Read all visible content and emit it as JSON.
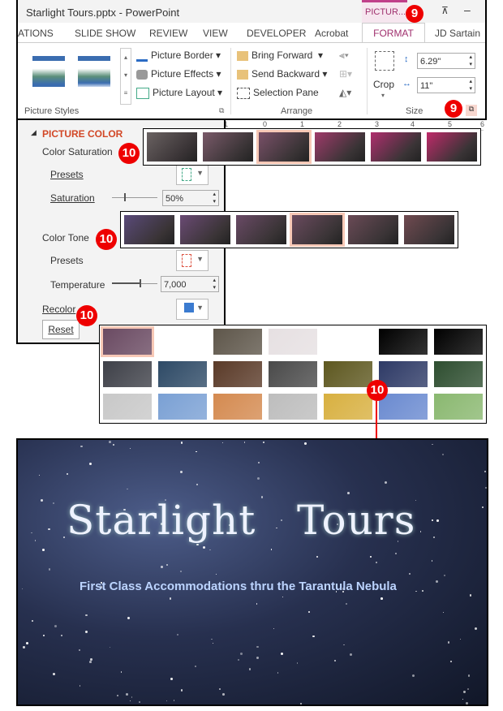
{
  "window": {
    "title": "Starlight Tours.pptx - PowerPoint",
    "contextual_tab": "PICTUR...",
    "user": "JD Sartain"
  },
  "tabs": [
    "ATIONS",
    "SLIDE SHOW",
    "REVIEW",
    "VIEW",
    "DEVELOPER",
    "Acrobat",
    "FORMAT"
  ],
  "ribbon": {
    "picture_styles": {
      "label": "Picture Styles",
      "border": "Picture Border",
      "effects": "Picture Effects",
      "layout": "Picture Layout"
    },
    "arrange": {
      "label": "Arrange",
      "bring_forward": "Bring Forward",
      "send_backward": "Send Backward",
      "selection_pane": "Selection Pane"
    },
    "size": {
      "label": "Size",
      "crop": "Crop",
      "height": "6.29\"",
      "width": "11\""
    }
  },
  "callouts": {
    "nine": "9",
    "ten": "10"
  },
  "panel": {
    "section": "PICTURE COLOR",
    "saturation_label": "Color Saturation",
    "presets": "Presets",
    "saturation": "Saturation",
    "saturation_value": "50%",
    "saturation_level": 0.5,
    "tone_label": "Color Tone",
    "temperature": "Temperature",
    "temperature_value": "7,000",
    "recolor": "Recolor",
    "reset": "Reset"
  },
  "ruler": [
    "1",
    "0",
    "1",
    "2",
    "3",
    "4",
    "5",
    "6"
  ],
  "saturation_presets": [
    "#6a6262",
    "#7a5a6a",
    "#7a5068",
    "#a03a6a",
    "#b02e6e",
    "#c02a6a"
  ],
  "tone_presets": [
    "#5a4a7a",
    "#6a4a74",
    "#6a4a66",
    "#6a4a5e",
    "#6a4a56",
    "#704a50"
  ],
  "recolor_presets": [
    [
      "#6a4a62",
      "#555",
      "#5e564a",
      "#e6e0e2",
      "#ffffff",
      "#000000",
      "#000000"
    ],
    [
      "#3e4048",
      "#2e4a66",
      "#5a3a28",
      "#4a4a4a",
      "#5e5820",
      "#2e3a66",
      "#2e4e30"
    ],
    [
      "#c8c8c8",
      "#7aa0d4",
      "#d48a50",
      "#bdbdbd",
      "#d8b040",
      "#6a8ad0",
      "#8ab870"
    ]
  ],
  "slide": {
    "title_1": "Starlight",
    "title_2": "Tours",
    "subtitle": "First Class Accommodations thru the Tarantula Nebula"
  }
}
